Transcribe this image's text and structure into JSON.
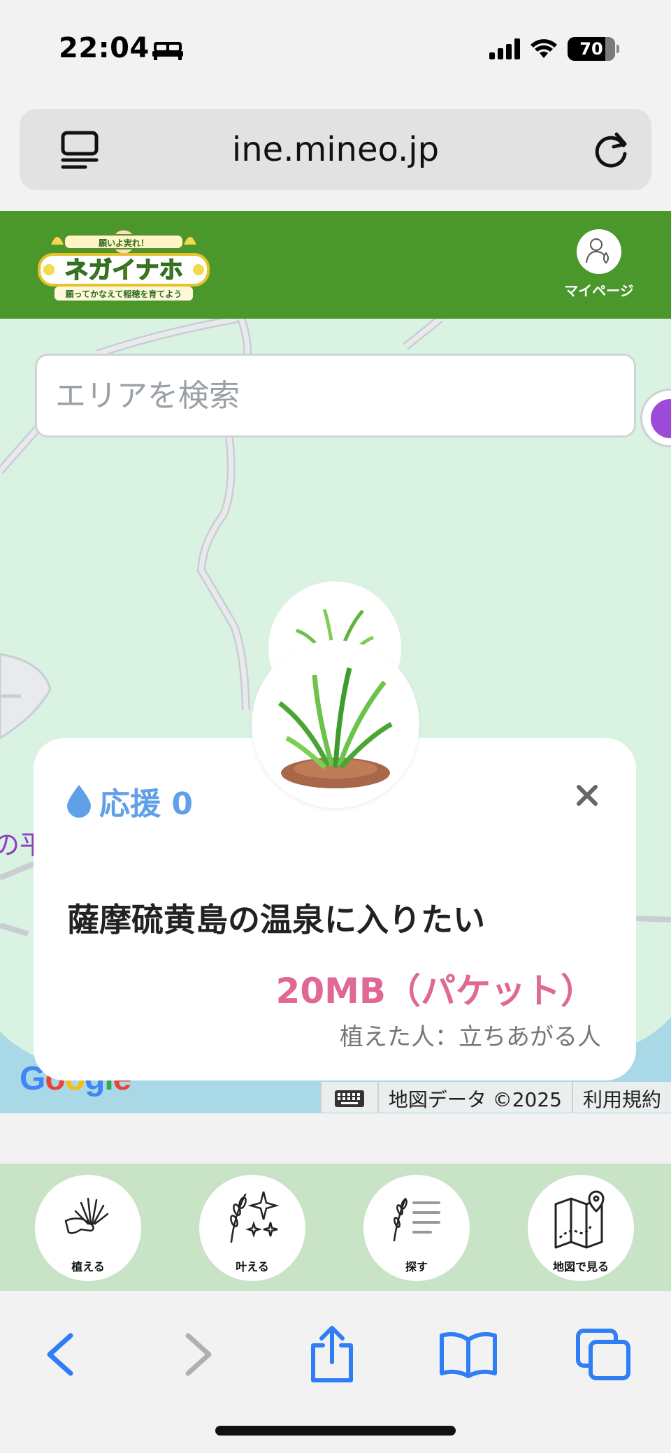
{
  "status": {
    "time": "22:04",
    "battery": "70",
    "icons": [
      "bed-icon",
      "signal-icon",
      "wifi-icon",
      "battery-icon"
    ]
  },
  "browser": {
    "url": "ine.mineo.jp",
    "icons": [
      "tab-menu-icon",
      "reload-icon"
    ]
  },
  "header": {
    "logo_top": "願いよ実れ！",
    "logo_name": "ネガイナホ",
    "logo_sub": "願ってかなえて稲穂を育てよう",
    "mypage_label": "マイページ"
  },
  "map": {
    "search_placeholder": "エリアを検索",
    "left_label": "の平",
    "google": "Google",
    "map_data": "地図データ ©2025",
    "terms": "利用規約"
  },
  "card": {
    "support_label": "応援 0",
    "title": "薩摩硫黄島の温泉に入りたい",
    "amount": "20MB（パケット）",
    "planter": "植えた人：立ちあがる人"
  },
  "nav": {
    "plant": "植える",
    "fulfill": "叶える",
    "search": "探す",
    "map_view": "地図で見る"
  },
  "colors": {
    "header_green": "#4a982c",
    "map_green": "#daf2e2",
    "nav_green": "#c8e3c6",
    "support_blue": "#5fa0e8",
    "amount_pink": "#e06894",
    "ios_blue": "#2f7ef5"
  }
}
